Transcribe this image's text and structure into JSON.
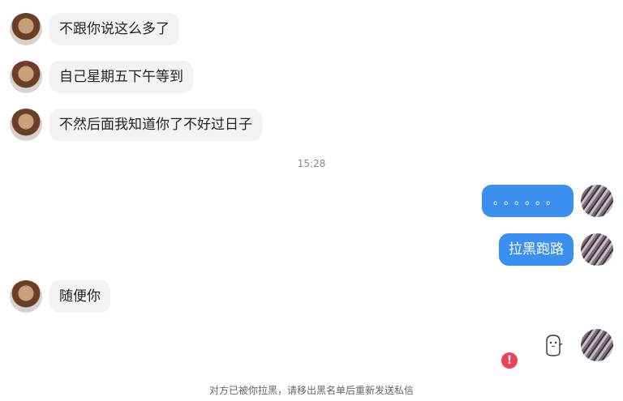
{
  "messages": [
    {
      "side": "left",
      "text": "不跟你说这么多了"
    },
    {
      "side": "left",
      "text": "自己星期五下午等到"
    },
    {
      "side": "left",
      "text": "不然后面我知道你了不好过日子"
    },
    {
      "side": "right",
      "text": "。。。。。。"
    },
    {
      "side": "right",
      "text": "拉黑跑路"
    },
    {
      "side": "left",
      "text": "随便你"
    }
  ],
  "timestamp": "15:28",
  "error_icon_text": "!",
  "blocked_notice": "对方已被你拉黑，请移出黑名单后重新发送私信",
  "colors": {
    "outgoing_bubble": "#3a8ff0",
    "incoming_bubble": "#f3f3f3",
    "error": "#f0405a"
  }
}
